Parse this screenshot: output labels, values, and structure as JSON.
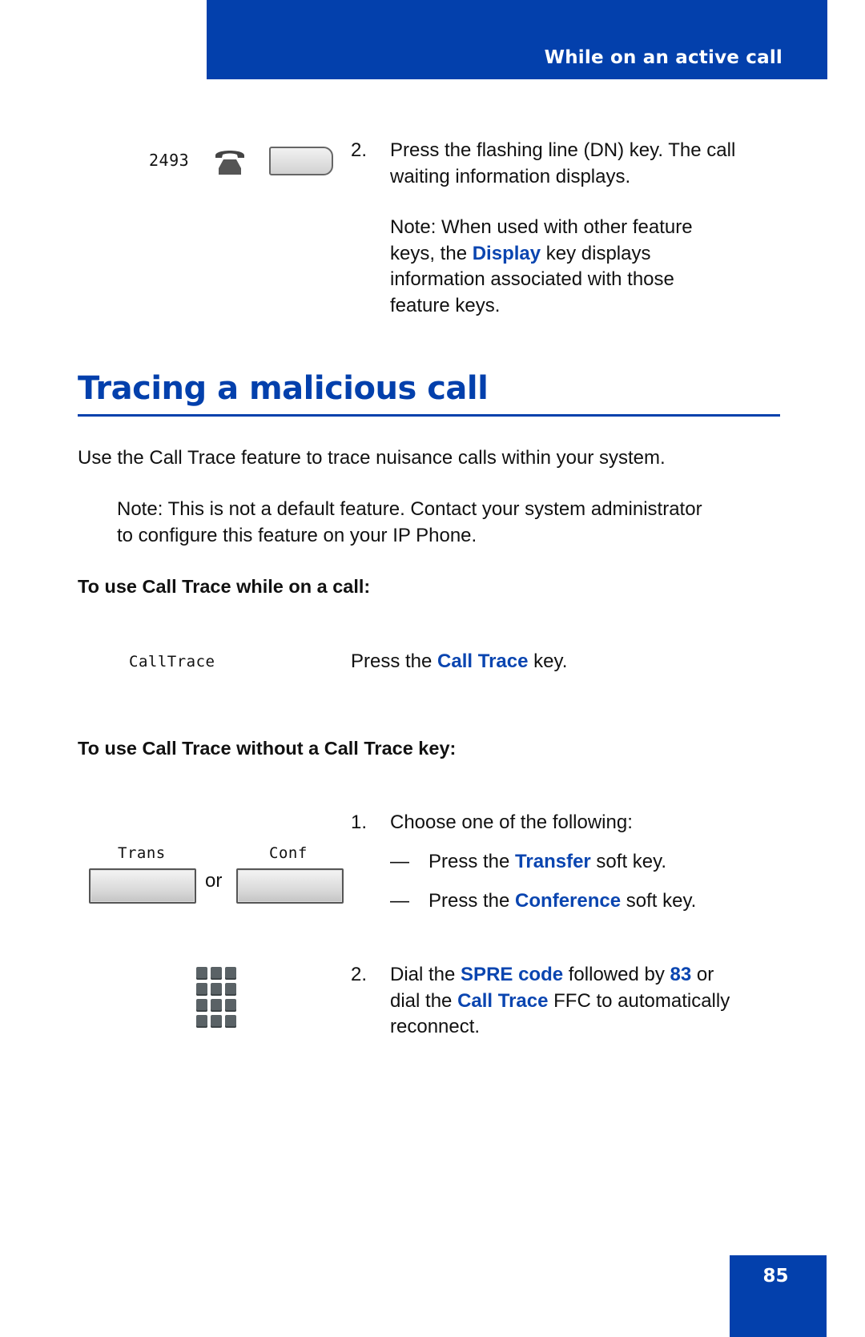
{
  "header": {
    "section_title": "While on an active call",
    "accent_color": "#0340ac"
  },
  "intro_step": {
    "display_number": "2493",
    "phone_icon": "telephone-handset-icon",
    "line_key_icon": "line-key-button",
    "number": "2.",
    "line1": "Press the flashing line (DN) key. The call",
    "line2": "waiting information displays.",
    "note": {
      "line1": "Note:  When used with other feature",
      "line2_pre": "keys, the ",
      "line2_hl": "Display",
      "line2_post": " key displays",
      "line3": "information associated with those",
      "line4": "feature keys."
    }
  },
  "section": {
    "title": "Tracing a malicious call",
    "intro": "Use the Call Trace feature to trace nuisance calls within your system.",
    "note_line1": "Note:  This is not a default feature. Contact your system administrator",
    "note_line2": "to configure this feature on your IP Phone."
  },
  "procedure1": {
    "heading": "To use Call Trace while on a call:",
    "softkey_label": "CallTrace",
    "text_pre": "Press the ",
    "text_hl": "Call Trace",
    "text_post": " key."
  },
  "procedure2": {
    "heading": "To use Call Trace without a Call Trace key:",
    "softkeys": [
      {
        "label": "Trans"
      },
      {
        "label": "Conf"
      }
    ],
    "or_label": "or",
    "keypad_icon": "dialpad-icon",
    "step1": {
      "number": "1.",
      "text": "Choose one of the following:",
      "options": [
        {
          "dash": "—",
          "pre": "Press the ",
          "hl": "Transfer",
          "post": " soft key."
        },
        {
          "dash": "—",
          "pre": "Press the ",
          "hl": "Conference",
          "post": " soft key."
        }
      ]
    },
    "step2": {
      "number": "2.",
      "l1_pre": "Dial the ",
      "l1_hl1": "SPRE code",
      "l1_mid": " followed by ",
      "l1_hl2": "83",
      "l1_post": " or",
      "l2_pre": "dial the ",
      "l2_hl": "Call Trace",
      "l2_post": " FFC to automatically",
      "l3": "reconnect."
    }
  },
  "footer": {
    "page_number": "85"
  }
}
